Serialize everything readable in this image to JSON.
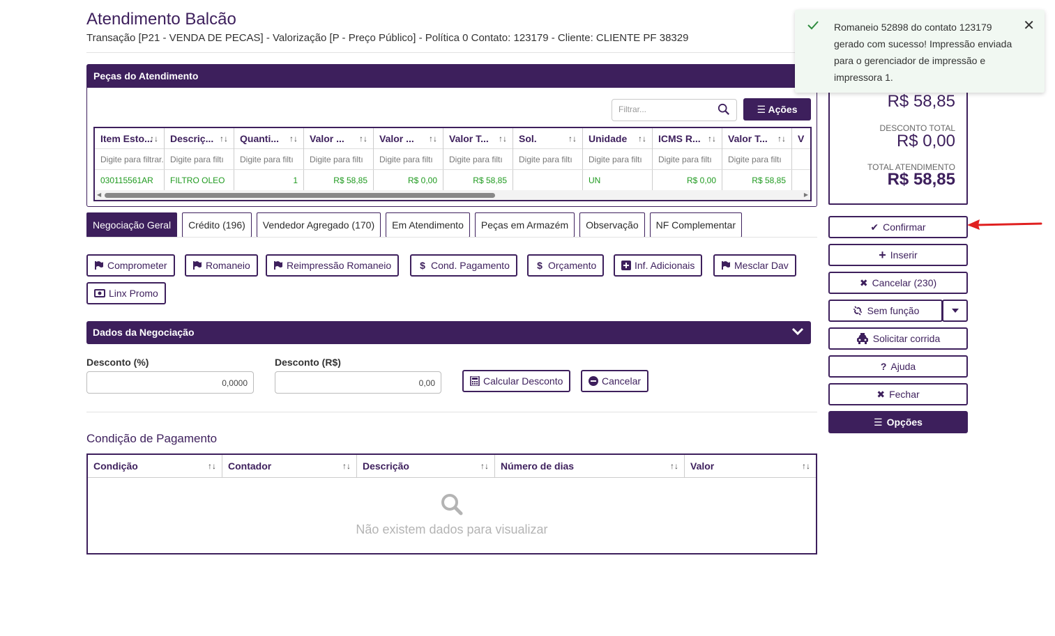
{
  "header": {
    "title": "Atendimento Balcão",
    "subtitle": "Transação [P21 - VENDA DE PECAS] - Valorização [P - Preço Público] - Política 0 Contato: 123179 - Cliente: CLIENTE PF 38329"
  },
  "pecas": {
    "title": "Peças do Atendimento",
    "filter_placeholder": "Filtrar...",
    "acoes_label": "Ações",
    "columns": [
      "Item Esto...",
      "Descriç...",
      "Quanti...",
      "Valor ...",
      "Valor ...",
      "Valor T...",
      "Sol.",
      "Unidade",
      "ICMS R...",
      "Valor T...",
      "V"
    ],
    "filter_placeholders": [
      "Digite para filtrar...",
      "Digite para filtı",
      "Digite para filtı",
      "Digite para filtı",
      "Digite para filtı",
      "Digite para filtı",
      "Digite para filtı",
      "Digite para filtı",
      "Digite para filtı",
      "Digite para filtı",
      ""
    ],
    "rows": [
      [
        "030115561AR",
        "FILTRO OLEO",
        "1",
        "R$ 58,85",
        "R$ 0,00",
        "R$ 58,85",
        "",
        "UN",
        "R$ 0,00",
        "R$ 58,85",
        ""
      ]
    ]
  },
  "tabs": [
    "Negociação Geral",
    "Crédito (196)",
    "Vendedor Agregado (170)",
    "Em Atendimento",
    "Peças em Armazém",
    "Observação",
    "NF Complementar"
  ],
  "actions": {
    "comprometer": "Comprometer",
    "romaneio": "Romaneio",
    "reimpressao": "Reimpressão Romaneio",
    "cond_pagamento": "Cond. Pagamento",
    "orcamento": "Orçamento",
    "inf_adicionais": "Inf. Adicionais",
    "mesclar_dav": "Mesclar Dav",
    "linx_promo": "Linx Promo"
  },
  "negociacao": {
    "title": "Dados da Negociação",
    "desconto_pct_label": "Desconto (%)",
    "desconto_pct_value": "0,0000",
    "desconto_rs_label": "Desconto (R$)",
    "desconto_rs_value": "0,00",
    "calcular_label": "Calcular Desconto",
    "cancelar_label": "Cancelar"
  },
  "condicao": {
    "title": "Condição de Pagamento",
    "columns": [
      "Condição",
      "Contador",
      "Descrição",
      "Número de dias",
      "Valor"
    ],
    "empty_text": "Não existem dados para visualizar"
  },
  "totals": {
    "subtotal_value": "R$ 58,85",
    "desconto_label": "DESCONTO TOTAL",
    "desconto_value": "R$ 0,00",
    "total_label": "TOTAL ATENDIMENTO",
    "total_value": "R$ 58,85"
  },
  "sidebar": {
    "confirmar": "Confirmar",
    "inserir": "Inserir",
    "cancelar": "Cancelar (230)",
    "sem_funcao": "Sem função",
    "solicitar_corrida": "Solicitar corrida",
    "ajuda": "Ajuda",
    "fechar": "Fechar",
    "opcoes": "Opções"
  },
  "toast": {
    "message": "Romaneio 52898 do contato 123179 gerado com sucesso! Impressão enviada para o gerenciador de impressão e impressora 1."
  },
  "colors": {
    "brand": "#3d1f5c",
    "positive": "#1f9a1f",
    "arrow": "#e02020",
    "toast_bg": "#f1f8f2"
  }
}
